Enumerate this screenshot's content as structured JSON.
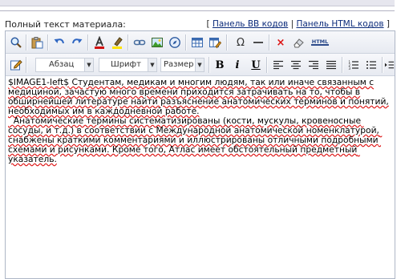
{
  "label": "Полный текст материала:",
  "panel_links": {
    "bracket_open": "[",
    "sep": "|",
    "bracket_close": "]",
    "bb": "Панель BB кодов",
    "html": "Панель HTML кодов"
  },
  "toolbar1": {
    "icons": [
      "preview-icon",
      "paste-icon",
      "undo-icon",
      "redo-icon",
      "text-color-icon",
      "highlight-icon",
      "link-icon",
      "image-icon",
      "navigator-icon",
      "table-icon",
      "table-edit-icon",
      "omega-icon",
      "horizontal-rule-icon",
      "remove-format-icon",
      "eraser-icon",
      "html-icon"
    ],
    "html_badge": "HTML"
  },
  "toolbar2": {
    "format_select": "Абзац",
    "font_select": "Шрифт",
    "size_select": "Размер",
    "bold_label": "B",
    "italic_label": "i",
    "underline_label": "U"
  },
  "content": {
    "tag": "$IMAGE1-left$",
    "p1": " Студентам, медикам и многим людям, так или иначе связанным с медициной, зачастую много времени приходится затрачивать на то, чтобы в обширнейшей литературе найти разъяснение анатомических терминов и понятий, необходимых им в каждодневной работе.",
    "p2": "  Анатомические термины систематизированы (кости, мускулы, кровеносные сосуды, и т.д.) в соответствии с Международной анатомической номенклатурой, снабжены краткими комментариями и иллюстрированы отличными подробными схемами и рисунками. Кроме того, Атлас имеет обстоятельный предметный указатель."
  },
  "colors": {
    "link": "#0a2a7a",
    "spell_underline": "#d11",
    "toolbar_top": "#f7f8fb",
    "toolbar_bottom": "#e7eaf1"
  }
}
